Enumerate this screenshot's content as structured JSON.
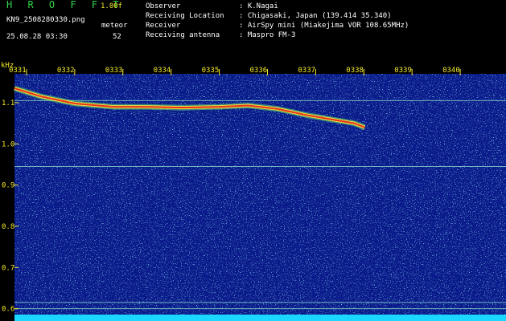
{
  "header": {
    "brand": "H R O F F T",
    "version": "1.00f",
    "filename": "KN9_2508280330.png",
    "datetime": "25.08.28 03:30",
    "meteor_label": "meteor",
    "meteor_count": "52",
    "meta": [
      {
        "label": "Observer",
        "value": ": K.Nagai"
      },
      {
        "label": "Receiving Location",
        "value": ": Chigasaki, Japan (139.414 35.340)"
      },
      {
        "label": "Receiver",
        "value": ": AirSpy mini (Miakejima VOR 108.65MHz)"
      },
      {
        "label": "Receiving antenna",
        "value": ": Maspro FM-3"
      }
    ]
  },
  "colors": {
    "background": "#000000",
    "plot_bg": "#0a1a8a",
    "text_green": "#2fd24a",
    "text_yellow": "#f4ea2a",
    "trace": "#e8301e"
  },
  "chart_data": {
    "type": "heatmap",
    "ylabel": "kHz",
    "y_ticks": [
      "1.1",
      "1.0",
      "0.9",
      "0.8",
      "0.7",
      "0.6"
    ],
    "y_tick_values": [
      1.1,
      1.0,
      0.9,
      0.8,
      0.7,
      0.6
    ],
    "ylim": [
      0.57,
      1.17
    ],
    "x_ticks": [
      "0331",
      "0332",
      "0333",
      "0334",
      "0335",
      "0336",
      "0337",
      "0338",
      "0339",
      "0340"
    ],
    "x_tick_values": [
      1,
      2,
      3,
      4,
      5,
      6,
      7,
      8,
      9,
      10
    ],
    "xlim": [
      0.75,
      10.95
    ],
    "horizontal_lines_khz": [
      1.105,
      0.945,
      0.615,
      0.6
    ],
    "trace": {
      "x": [
        0.75,
        1.3,
        2.0,
        2.8,
        3.5,
        4.2,
        5.0,
        5.6,
        6.2,
        6.8,
        7.3,
        7.8,
        8.02
      ],
      "y": [
        1.135,
        1.115,
        1.098,
        1.09,
        1.09,
        1.088,
        1.09,
        1.093,
        1.085,
        1.07,
        1.06,
        1.05,
        1.04
      ]
    }
  }
}
